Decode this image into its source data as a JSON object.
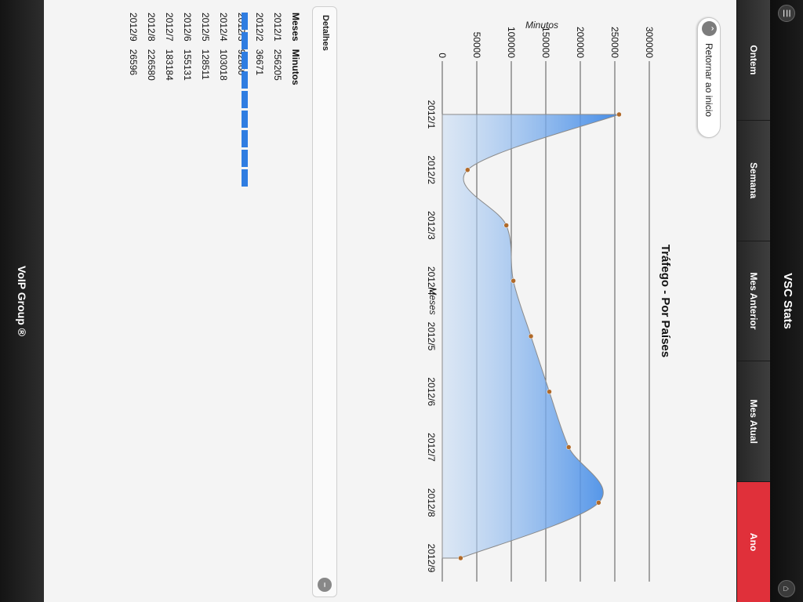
{
  "header": {
    "title": "VSC Stats"
  },
  "nav": [
    {
      "label": "Ontem",
      "active": false
    },
    {
      "label": "Semana",
      "active": false
    },
    {
      "label": "Mes Anterior",
      "active": false
    },
    {
      "label": "Mes Atual",
      "active": false
    },
    {
      "label": "Ano",
      "active": true
    }
  ],
  "back_button": {
    "label": "Retornar ao inicio"
  },
  "chart_data": {
    "type": "area",
    "title": "Tráfego - Por Países",
    "xlabel": "Meses",
    "ylabel": "Minutos",
    "categories": [
      "2012/1",
      "2012/2",
      "2012/3",
      "2012/4",
      "2012/5",
      "2012/6",
      "2012/7",
      "2012/8",
      "2012/9"
    ],
    "y_ticks": [
      "0",
      "50000",
      "100000",
      "150000",
      "200000",
      "250000",
      "300000"
    ],
    "ylim": [
      0,
      300000
    ],
    "series": [
      {
        "values": [
          256205,
          36671,
          92860,
          103018,
          128511,
          155131,
          183184,
          226580,
          26596
        ]
      }
    ],
    "grid": true,
    "colors": {
      "fill": "#5a9be8",
      "line": "#8a8a8a",
      "marker": "#b06a2a"
    }
  },
  "details": {
    "label": "Detalhes",
    "columns": [
      "Meses",
      "Minutos"
    ],
    "rows": [
      [
        "2012/1",
        "256205"
      ],
      [
        "2012/2",
        "36671"
      ],
      [
        "2012/3",
        "92860"
      ],
      [
        "2012/4",
        "103018"
      ],
      [
        "2012/5",
        "128511"
      ],
      [
        "2012/6",
        "155131"
      ],
      [
        "2012/7",
        "183184"
      ],
      [
        "2012/8",
        "226580"
      ],
      [
        "2012/9",
        "26596"
      ]
    ]
  },
  "footer": {
    "text": "VoIP Group ®"
  },
  "colors": {
    "accent": "#e0303a",
    "table_bar": "#2f7de1"
  }
}
